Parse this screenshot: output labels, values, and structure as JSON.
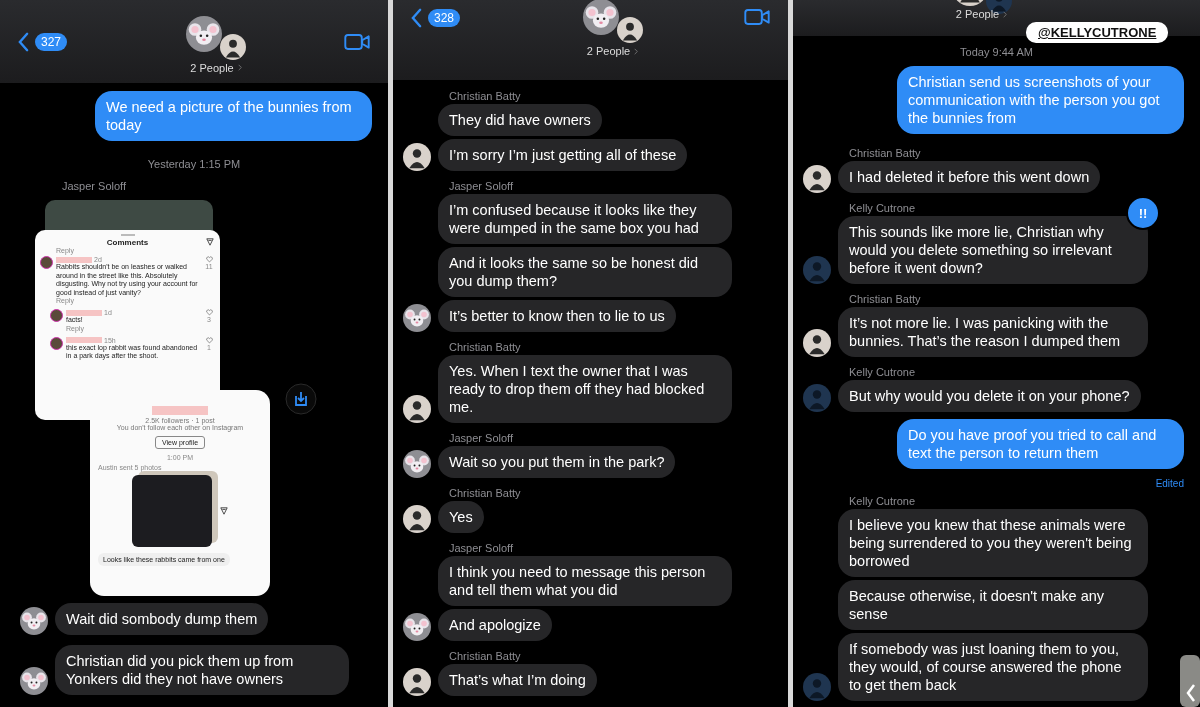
{
  "panels": [
    {
      "header": {
        "kind": "full",
        "count": "327",
        "people": "2 People"
      },
      "messages": [
        {
          "kind": "outgoing",
          "text": "We need a picture of the bunnies from today"
        },
        {
          "kind": "timestamp",
          "text": "Yesterday 1:15 PM"
        },
        {
          "kind": "sender",
          "text": "Jasper  Soloff"
        },
        {
          "kind": "attachment",
          "comments_title": "Comments",
          "top_reply": "Reply",
          "comments": [
            {
              "time": "2d",
              "text": "Rabbits shouldn't be on leashes or walked around in the street like this. Absolutely disgusting. Why not try using your account for good instead of just vanity?",
              "likes": "11",
              "reply": "Reply"
            },
            {
              "time": "1d",
              "text": "facts!",
              "likes": "3",
              "reply": "Reply"
            },
            {
              "time": "15h",
              "text": "this exact lop rabbit was found abandoned in a park days after the shoot.",
              "likes": "1"
            }
          ],
          "profile": {
            "stats": "2.5K followers · 1 post",
            "note": "You don't follow each other on Instagram",
            "button": "View profile",
            "time": "1:00 PM",
            "sent": "Austin sent 5 photos",
            "message": "Looks like these rabbits came from one"
          }
        },
        {
          "kind": "incoming",
          "avatar": {
            "kind": "animoji"
          },
          "text": "Wait did sombody dump them"
        },
        {
          "kind": "incoming",
          "avatar": {
            "kind": "animoji"
          },
          "text": "Christian did you pick them up from Yonkers did they not have owners"
        }
      ]
    },
    {
      "header": {
        "kind": "full",
        "count": "328",
        "people": "2 People"
      },
      "messages": [
        {
          "kind": "sender",
          "text": "Christian Batty"
        },
        {
          "kind": "incoming",
          "text": "They did have owners"
        },
        {
          "kind": "incoming",
          "avatar": {
            "kind": "photo"
          },
          "text": "I’m sorry I’m just getting all of these"
        },
        {
          "kind": "sender",
          "text": "Jasper  Soloff"
        },
        {
          "kind": "incoming",
          "text": "I’m confused because it looks like they were dumped in the same box you had"
        },
        {
          "kind": "incoming",
          "text": "And it looks the same so be honest did you dump them?"
        },
        {
          "kind": "incoming",
          "avatar": {
            "kind": "animoji"
          },
          "text": "It’s better to know then to lie to us"
        },
        {
          "kind": "sender",
          "text": "Christian Batty"
        },
        {
          "kind": "incoming",
          "avatar": {
            "kind": "photo"
          },
          "text": "Yes. When I text the owner that I was ready to drop them off they had blocked me."
        },
        {
          "kind": "sender",
          "text": "Jasper  Soloff"
        },
        {
          "kind": "incoming",
          "avatar": {
            "kind": "animoji"
          },
          "text": "Wait so you put them in the park?"
        },
        {
          "kind": "sender",
          "text": "Christian Batty"
        },
        {
          "kind": "incoming",
          "avatar": {
            "kind": "photo"
          },
          "text": "Yes"
        },
        {
          "kind": "sender",
          "text": "Jasper  Soloff"
        },
        {
          "kind": "incoming",
          "text": "I think you need to message this person and tell them what you did"
        },
        {
          "kind": "incoming",
          "avatar": {
            "kind": "animoji"
          },
          "text": "And apologize"
        },
        {
          "kind": "sender",
          "text": "Christian Batty"
        },
        {
          "kind": "incoming",
          "avatar": {
            "kind": "photo"
          },
          "text": "That’s what I’m doing"
        }
      ]
    },
    {
      "header": {
        "kind": "cropped",
        "people": "2 People"
      },
      "sticker": "@KELLYCUTRONE",
      "messages": [
        {
          "kind": "timestamp",
          "text": "Today 9:44 AM"
        },
        {
          "kind": "outgoing",
          "text": "Christian send us screenshots of your communication with the person you got the bunnies from"
        },
        {
          "kind": "sender",
          "text": "Christian Batty"
        },
        {
          "kind": "incoming",
          "avatar": {
            "kind": "photo"
          },
          "text": "I had deleted it before this went down"
        },
        {
          "kind": "sender",
          "text": "Kelly Cutrone"
        },
        {
          "kind": "incoming",
          "avatar": {
            "kind": "photo_dark"
          },
          "text": "This sounds like more lie, Christian why would you delete something so irrelevant before it went down?",
          "reaction": "!!"
        },
        {
          "kind": "sender",
          "text": "Christian Batty"
        },
        {
          "kind": "incoming",
          "avatar": {
            "kind": "photo"
          },
          "text": "It’s not more lie. I was panicking with the bunnies. That’s the reason I dumped them"
        },
        {
          "kind": "sender",
          "text": "Kelly Cutrone"
        },
        {
          "kind": "incoming",
          "avatar": {
            "kind": "photo_dark"
          },
          "text": "But why would you delete it on your phone?"
        },
        {
          "kind": "outgoing",
          "text": "Do you have proof you tried to call and text the person to return them"
        },
        {
          "kind": "edited",
          "text": "Edited"
        },
        {
          "kind": "sender",
          "text": "Kelly Cutrone"
        },
        {
          "kind": "incoming",
          "text": "I believe you knew that these animals were being surrendered to you they weren't being borrowed"
        },
        {
          "kind": "incoming",
          "text": "Because otherwise, it doesn't make any sense"
        },
        {
          "kind": "incoming",
          "avatar": {
            "kind": "photo_dark"
          },
          "text": "If somebody was just loaning them to you, they would, of course answered the phone to get them back"
        }
      ]
    }
  ]
}
